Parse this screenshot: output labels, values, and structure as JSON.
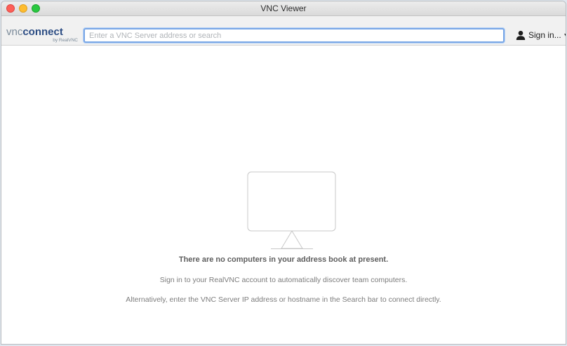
{
  "window": {
    "title": "VNC Viewer"
  },
  "toolbar": {
    "brand": {
      "vnc": "vnc",
      "connect": "connect",
      "by": "by RealVNC"
    },
    "search": {
      "placeholder": "Enter a VNC Server address or search",
      "value": ""
    },
    "signin": {
      "label": "Sign in...",
      "icon": "user-icon",
      "caret_icon": "chevron-down-icon"
    }
  },
  "empty_state": {
    "icon": "monitor-icon",
    "title": "There are no computers in your address book at present.",
    "line1": "Sign in to your RealVNC account to automatically discover team computers.",
    "line2": "Alternatively, enter the VNC Server IP address or hostname in the Search bar to connect directly."
  },
  "colors": {
    "brand_blue": "#2c4d84",
    "brand_gray": "#7a8a99",
    "focus_ring": "#7aa7e6",
    "close": "#fd5f57",
    "minimize": "#febc2e",
    "zoom": "#29c840"
  }
}
